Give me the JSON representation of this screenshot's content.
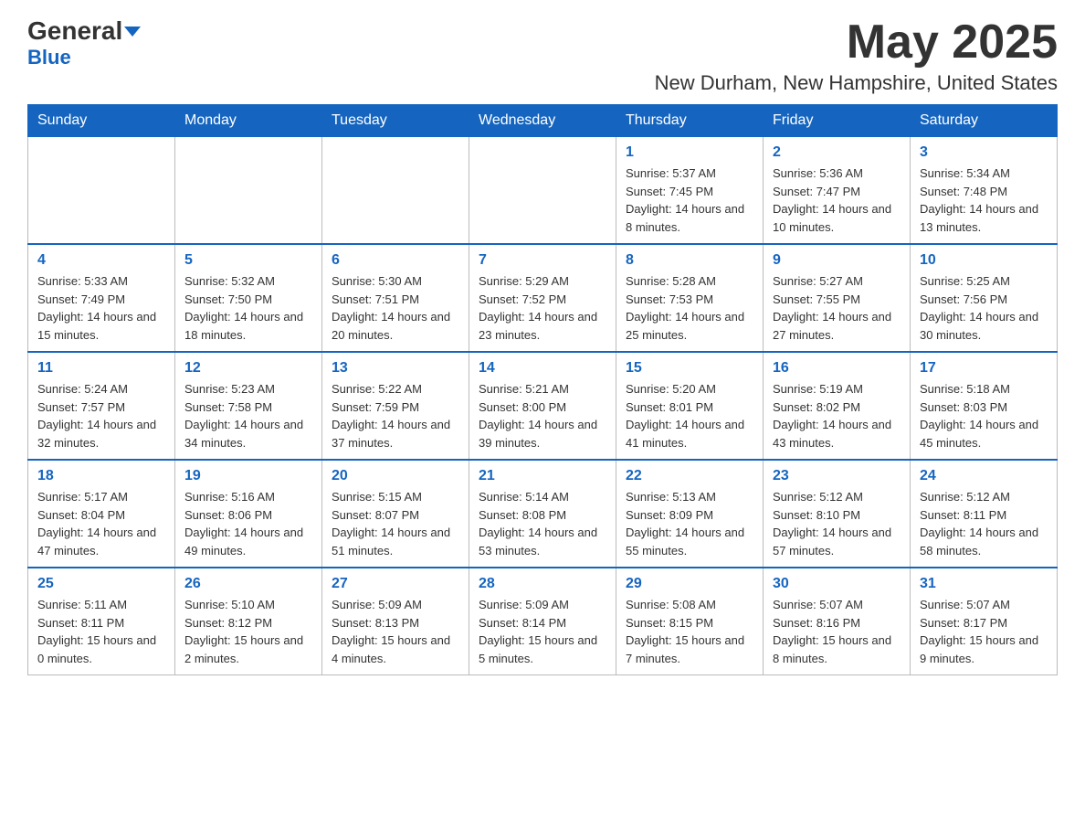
{
  "header": {
    "logo_text1": "General",
    "logo_text2": "Blue",
    "month_year": "May 2025",
    "location": "New Durham, New Hampshire, United States"
  },
  "weekdays": [
    "Sunday",
    "Monday",
    "Tuesday",
    "Wednesday",
    "Thursday",
    "Friday",
    "Saturday"
  ],
  "weeks": [
    [
      {
        "day": "",
        "info": ""
      },
      {
        "day": "",
        "info": ""
      },
      {
        "day": "",
        "info": ""
      },
      {
        "day": "",
        "info": ""
      },
      {
        "day": "1",
        "info": "Sunrise: 5:37 AM\nSunset: 7:45 PM\nDaylight: 14 hours and 8 minutes."
      },
      {
        "day": "2",
        "info": "Sunrise: 5:36 AM\nSunset: 7:47 PM\nDaylight: 14 hours and 10 minutes."
      },
      {
        "day": "3",
        "info": "Sunrise: 5:34 AM\nSunset: 7:48 PM\nDaylight: 14 hours and 13 minutes."
      }
    ],
    [
      {
        "day": "4",
        "info": "Sunrise: 5:33 AM\nSunset: 7:49 PM\nDaylight: 14 hours and 15 minutes."
      },
      {
        "day": "5",
        "info": "Sunrise: 5:32 AM\nSunset: 7:50 PM\nDaylight: 14 hours and 18 minutes."
      },
      {
        "day": "6",
        "info": "Sunrise: 5:30 AM\nSunset: 7:51 PM\nDaylight: 14 hours and 20 minutes."
      },
      {
        "day": "7",
        "info": "Sunrise: 5:29 AM\nSunset: 7:52 PM\nDaylight: 14 hours and 23 minutes."
      },
      {
        "day": "8",
        "info": "Sunrise: 5:28 AM\nSunset: 7:53 PM\nDaylight: 14 hours and 25 minutes."
      },
      {
        "day": "9",
        "info": "Sunrise: 5:27 AM\nSunset: 7:55 PM\nDaylight: 14 hours and 27 minutes."
      },
      {
        "day": "10",
        "info": "Sunrise: 5:25 AM\nSunset: 7:56 PM\nDaylight: 14 hours and 30 minutes."
      }
    ],
    [
      {
        "day": "11",
        "info": "Sunrise: 5:24 AM\nSunset: 7:57 PM\nDaylight: 14 hours and 32 minutes."
      },
      {
        "day": "12",
        "info": "Sunrise: 5:23 AM\nSunset: 7:58 PM\nDaylight: 14 hours and 34 minutes."
      },
      {
        "day": "13",
        "info": "Sunrise: 5:22 AM\nSunset: 7:59 PM\nDaylight: 14 hours and 37 minutes."
      },
      {
        "day": "14",
        "info": "Sunrise: 5:21 AM\nSunset: 8:00 PM\nDaylight: 14 hours and 39 minutes."
      },
      {
        "day": "15",
        "info": "Sunrise: 5:20 AM\nSunset: 8:01 PM\nDaylight: 14 hours and 41 minutes."
      },
      {
        "day": "16",
        "info": "Sunrise: 5:19 AM\nSunset: 8:02 PM\nDaylight: 14 hours and 43 minutes."
      },
      {
        "day": "17",
        "info": "Sunrise: 5:18 AM\nSunset: 8:03 PM\nDaylight: 14 hours and 45 minutes."
      }
    ],
    [
      {
        "day": "18",
        "info": "Sunrise: 5:17 AM\nSunset: 8:04 PM\nDaylight: 14 hours and 47 minutes."
      },
      {
        "day": "19",
        "info": "Sunrise: 5:16 AM\nSunset: 8:06 PM\nDaylight: 14 hours and 49 minutes."
      },
      {
        "day": "20",
        "info": "Sunrise: 5:15 AM\nSunset: 8:07 PM\nDaylight: 14 hours and 51 minutes."
      },
      {
        "day": "21",
        "info": "Sunrise: 5:14 AM\nSunset: 8:08 PM\nDaylight: 14 hours and 53 minutes."
      },
      {
        "day": "22",
        "info": "Sunrise: 5:13 AM\nSunset: 8:09 PM\nDaylight: 14 hours and 55 minutes."
      },
      {
        "day": "23",
        "info": "Sunrise: 5:12 AM\nSunset: 8:10 PM\nDaylight: 14 hours and 57 minutes."
      },
      {
        "day": "24",
        "info": "Sunrise: 5:12 AM\nSunset: 8:11 PM\nDaylight: 14 hours and 58 minutes."
      }
    ],
    [
      {
        "day": "25",
        "info": "Sunrise: 5:11 AM\nSunset: 8:11 PM\nDaylight: 15 hours and 0 minutes."
      },
      {
        "day": "26",
        "info": "Sunrise: 5:10 AM\nSunset: 8:12 PM\nDaylight: 15 hours and 2 minutes."
      },
      {
        "day": "27",
        "info": "Sunrise: 5:09 AM\nSunset: 8:13 PM\nDaylight: 15 hours and 4 minutes."
      },
      {
        "day": "28",
        "info": "Sunrise: 5:09 AM\nSunset: 8:14 PM\nDaylight: 15 hours and 5 minutes."
      },
      {
        "day": "29",
        "info": "Sunrise: 5:08 AM\nSunset: 8:15 PM\nDaylight: 15 hours and 7 minutes."
      },
      {
        "day": "30",
        "info": "Sunrise: 5:07 AM\nSunset: 8:16 PM\nDaylight: 15 hours and 8 minutes."
      },
      {
        "day": "31",
        "info": "Sunrise: 5:07 AM\nSunset: 8:17 PM\nDaylight: 15 hours and 9 minutes."
      }
    ]
  ]
}
